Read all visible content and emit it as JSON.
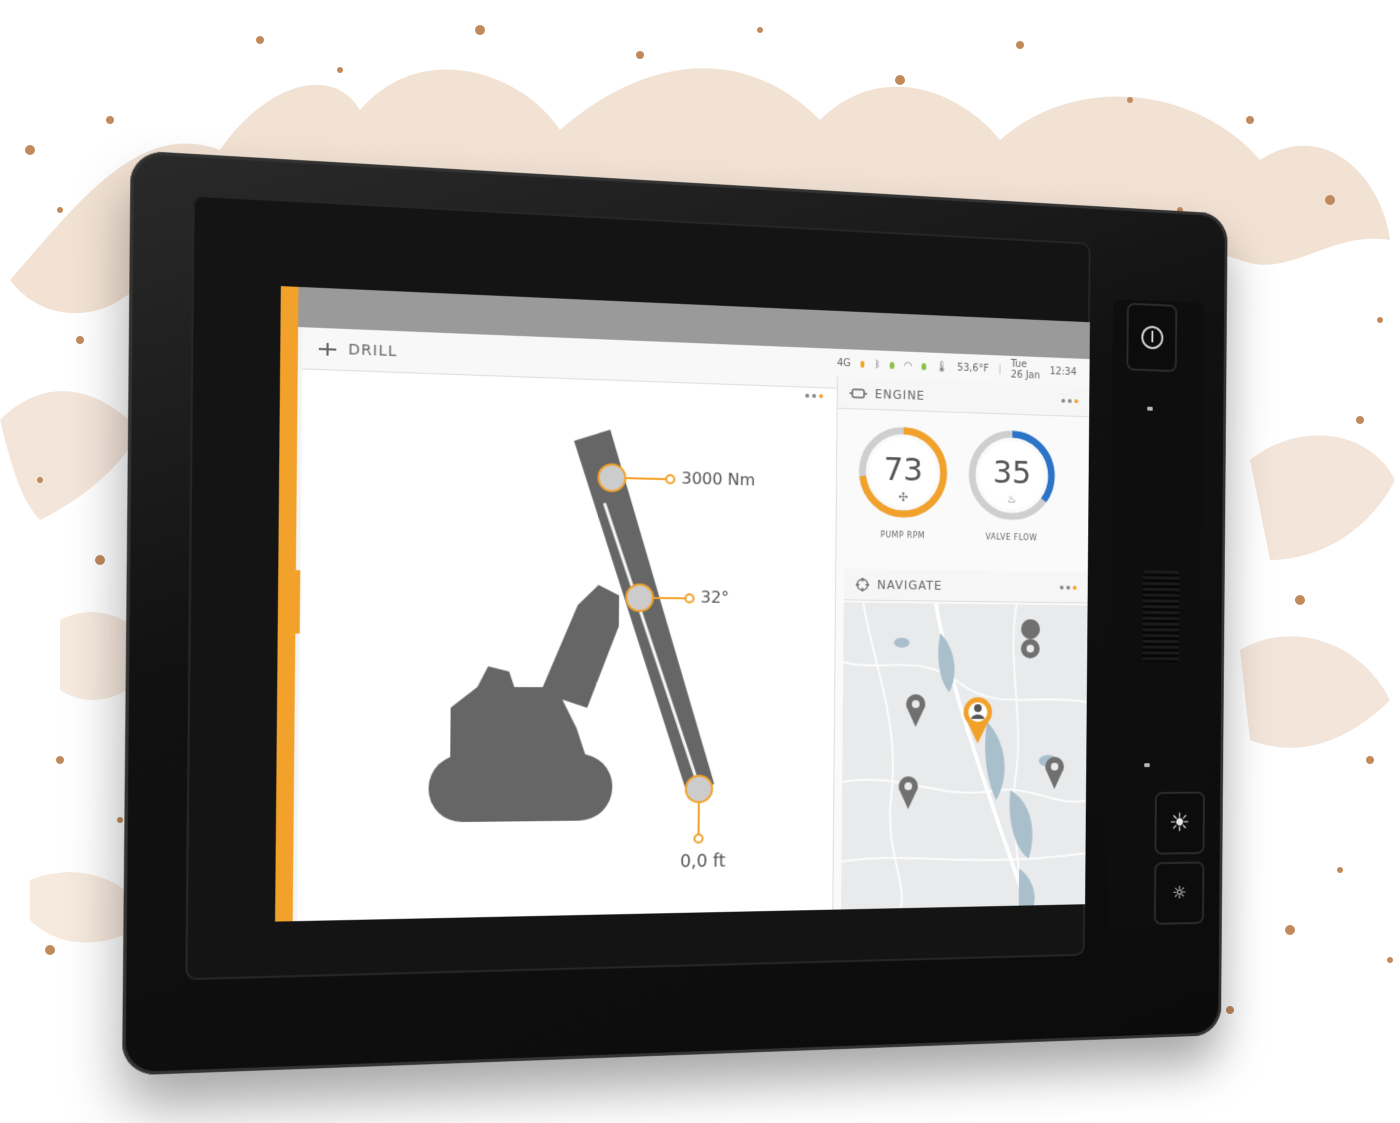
{
  "drill_panel": {
    "title": "DRILL",
    "torque_label": "3000 Nm",
    "angle_label": "32°",
    "depth_label": "0,0 ft"
  },
  "status_bar": {
    "network": "4G",
    "temperature": "53,6°F",
    "date": "Tue 26 Jan",
    "time": "12:34"
  },
  "engine_panel": {
    "title": "ENGINE",
    "gauges": [
      {
        "value": "73",
        "label": "PUMP RPM",
        "fill_fraction": 0.73,
        "color": "#f2a22a"
      },
      {
        "value": "35",
        "label": "VALVE FLOW",
        "fill_fraction": 0.35,
        "color": "#2b74c7"
      }
    ]
  },
  "navigate_panel": {
    "title": "NAVIGATE"
  },
  "colors": {
    "accent": "#f2a22a",
    "gauge_blue": "#2b74c7",
    "status_green": "#8bc34a",
    "status_orange": "#f2a22a"
  },
  "icons": {
    "drill": "drill-icon",
    "engine": "engine-icon",
    "navigate": "crosshair-icon",
    "power": "power-icon",
    "brightness_up": "sun-icon",
    "brightness_down": "small-sun-icon",
    "location_pin": "map-pin-icon",
    "user_pin": "user-location-icon"
  }
}
